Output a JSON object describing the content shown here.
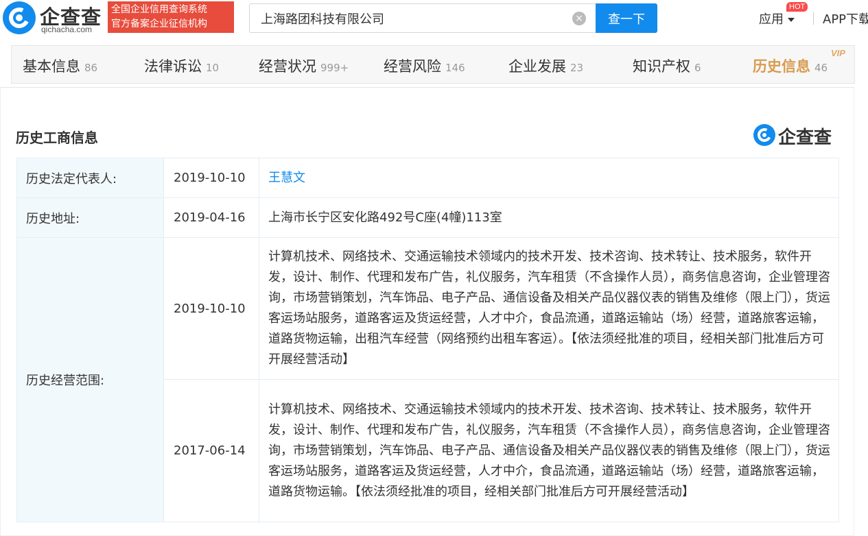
{
  "header": {
    "logo_text": "企查查",
    "logo_sub": "qichacha.com",
    "badge_line1": "全国企业信用查询系统",
    "badge_line2": "官方备案企业征信机构",
    "search_value": "上海路团科技有限公司",
    "search_button": "查一下",
    "app_menu": "应用",
    "hot_badge": "HOT",
    "app_download": "APP下载"
  },
  "tabs": [
    {
      "label": "基本信息",
      "count": "86"
    },
    {
      "label": "法律诉讼",
      "count": "10"
    },
    {
      "label": "经营状况",
      "count": "999+"
    },
    {
      "label": "经营风险",
      "count": "146"
    },
    {
      "label": "企业发展",
      "count": "23"
    },
    {
      "label": "知识产权",
      "count": "6"
    },
    {
      "label": "历史信息",
      "count": "46"
    }
  ],
  "vip_badge": "VIP",
  "section": {
    "title": "历史工商信息",
    "brand": "企查查"
  },
  "history": {
    "legal_rep": {
      "label": "历史法定代表人:",
      "date": "2019-10-10",
      "value": "王慧文"
    },
    "address": {
      "label": "历史地址:",
      "date": "2019-04-16",
      "value": "上海市长宁区安化路492号C座(4幢)113室"
    },
    "scope": {
      "label": "历史经营范围:",
      "entries": [
        {
          "date": "2019-10-10",
          "value": "计算机技术、网络技术、交通运输技术领域内的技术开发、技术咨询、技术转让、技术服务，软件开发，设计、制作、代理和发布广告，礼仪服务，汽车租赁（不含操作人员），商务信息咨询，企业管理咨询，市场营销策划，汽车饰品、电子产品、通信设备及相关产品仪器仪表的销售及维修（限上门），货运客运场站服务，道路客运及货运经营，人才中介，食品流通，道路运输站（场）经营，道路旅客运输，道路货物运输，出租汽车经营（网络预约出租车客运）。【依法须经批准的项目，经相关部门批准后方可开展经营活动】"
        },
        {
          "date": "2017-06-14",
          "value": "计算机技术、网络技术、交通运输技术领域内的技术开发、技术咨询、技术转让、技术服务，软件开发，设计、制作、代理和发布广告，礼仪服务，汽车租赁（不含操作人员），商务信息咨询，企业管理咨询，市场营销策划，汽车饰品、电子产品、通信设备及相关产品仪器仪表的销售及维修（限上门），货运客运场站服务，道路客运及货运经营，人才中介，食品流通，道路运输站（场）经营，道路旅客运输，道路货物运输。【依法须经批准的项目，经相关部门批准后方可开展经营活动】"
        }
      ]
    }
  },
  "colors": {
    "brand_blue": "#128bed",
    "badge_red": "#e74c3c",
    "active_tab": "#d89b4f",
    "label_bg": "#f2f9fc"
  }
}
